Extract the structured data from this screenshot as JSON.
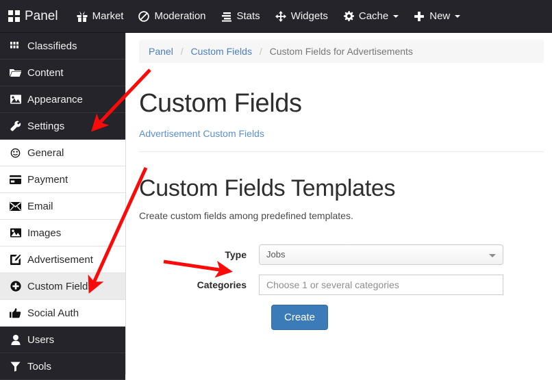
{
  "navbar": {
    "brand": {
      "label": "Panel",
      "icon": "grid-icon"
    },
    "items": [
      {
        "label": "Market",
        "icon": "gift-icon",
        "caret": false
      },
      {
        "label": "Moderation",
        "icon": "ban-icon",
        "caret": false
      },
      {
        "label": "Stats",
        "icon": "bar-chart-icon",
        "caret": false
      },
      {
        "label": "Widgets",
        "icon": "move-arrows-icon",
        "caret": false
      },
      {
        "label": "Cache",
        "icon": "gear-icon",
        "caret": true
      },
      {
        "label": "New",
        "icon": "plus-icon",
        "caret": true
      }
    ],
    "background": "#24242a"
  },
  "sidebar": {
    "items": [
      {
        "label": "Classifieds",
        "icon": "grid-small-icon",
        "style": "dark",
        "active": false
      },
      {
        "label": "Content",
        "icon": "folder-icon",
        "style": "dark",
        "active": false
      },
      {
        "label": "Appearance",
        "icon": "image-icon",
        "style": "dark",
        "active": false
      },
      {
        "label": "Settings",
        "icon": "wrench-icon",
        "style": "dark",
        "active": false
      },
      {
        "label": "General",
        "icon": "clock-icon",
        "style": "light",
        "active": false
      },
      {
        "label": "Payment",
        "icon": "credit-card-icon",
        "style": "light",
        "active": false
      },
      {
        "label": "Email",
        "icon": "envelope-icon",
        "style": "light",
        "active": false
      },
      {
        "label": "Images",
        "icon": "image-icon",
        "style": "light",
        "active": false
      },
      {
        "label": "Advertisement",
        "icon": "edit-square-icon",
        "style": "light",
        "active": false
      },
      {
        "label": "Custom Fields",
        "icon": "plus-circle-icon",
        "style": "light",
        "active": true
      },
      {
        "label": "Social Auth",
        "icon": "thumbs-up-icon",
        "style": "light",
        "active": false
      },
      {
        "label": "Users",
        "icon": "user-icon",
        "style": "dark",
        "active": false
      },
      {
        "label": "Tools",
        "icon": "funnel-icon",
        "style": "dark",
        "active": false
      }
    ],
    "active_background": "#ebebeb"
  },
  "breadcrumb": {
    "root": "Panel",
    "parent": "Custom Fields",
    "current": "Custom Fields for Advertisements",
    "separator": "/"
  },
  "main": {
    "page_title": "Custom Fields",
    "sub_link": "Advertisement Custom Fields",
    "section_title": "Custom Fields Templates",
    "section_desc": "Create custom fields among predefined templates."
  },
  "form": {
    "type": {
      "label": "Type",
      "value": "Jobs",
      "options": [
        "Jobs"
      ]
    },
    "categories": {
      "label": "Categories",
      "value": "",
      "placeholder": "Choose 1 or several categories"
    },
    "submit": {
      "label": "Create",
      "color": "#3b7cb8"
    }
  },
  "annotations": {
    "arrow_color": "#fb0a0a",
    "arrows": [
      {
        "name": "arrow-to-settings",
        "from": [
          219,
          102
        ],
        "to": [
          139,
          186
        ]
      },
      {
        "name": "arrow-to-custom-fields",
        "from": [
          213,
          245
        ],
        "to": [
          132,
          421
        ]
      },
      {
        "name": "arrow-to-type-field",
        "from": [
          239,
          382
        ],
        "to": [
          331,
          396
        ]
      }
    ]
  }
}
